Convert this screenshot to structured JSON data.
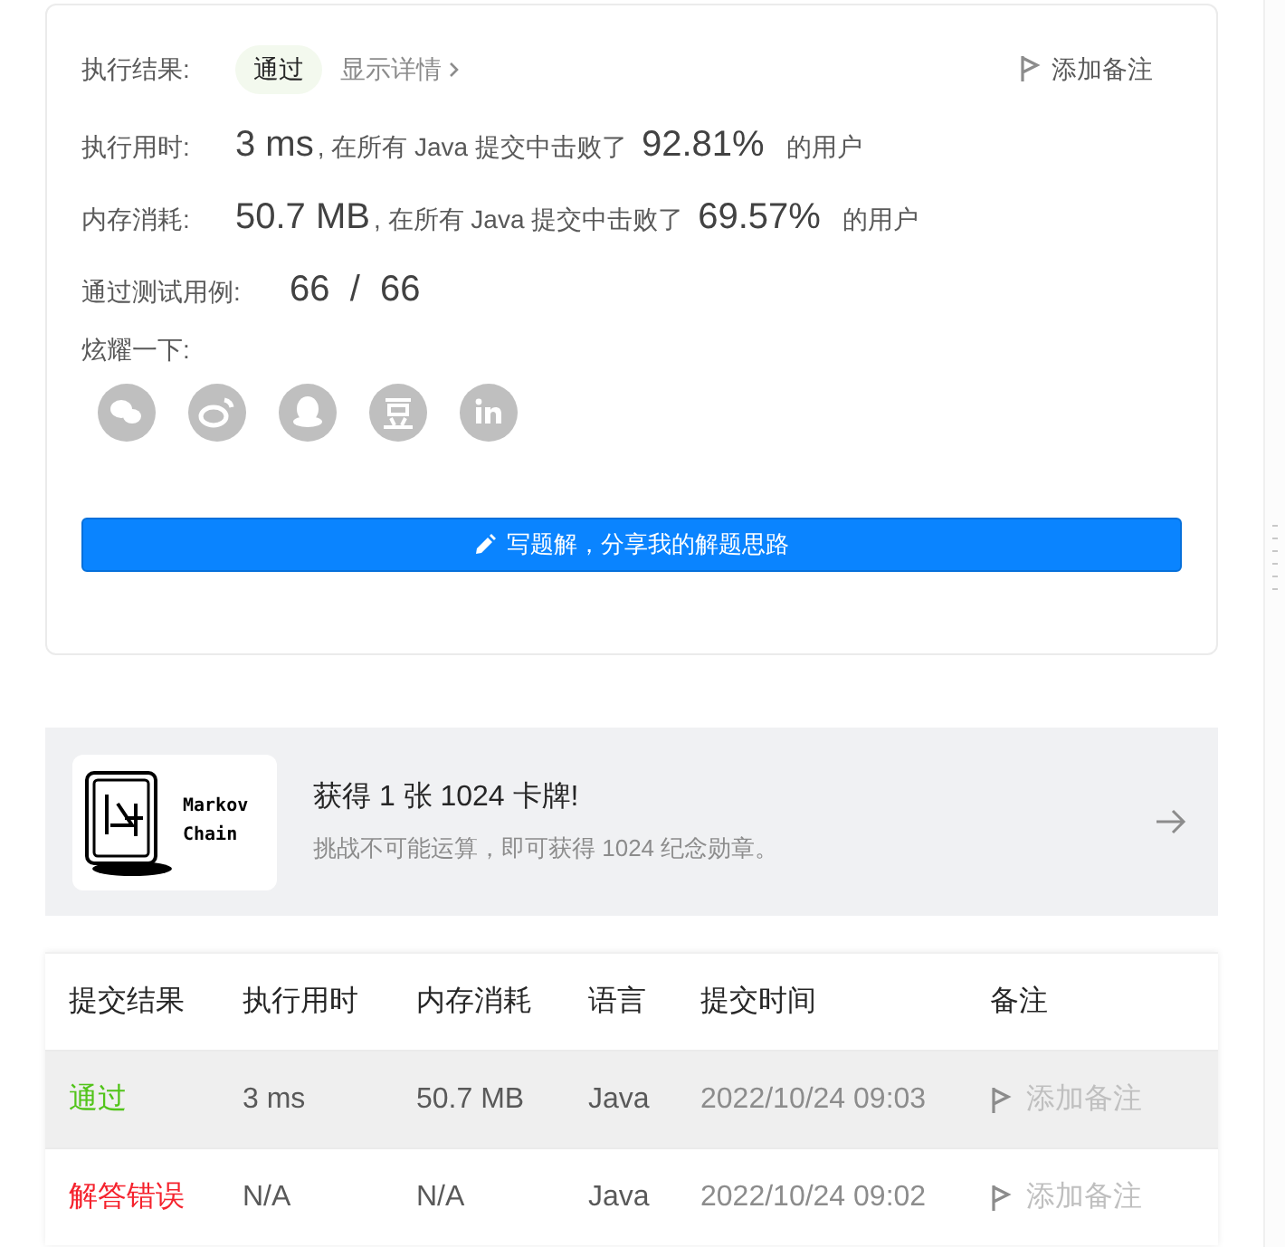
{
  "result": {
    "label": "执行结果:",
    "badge": "通过",
    "details_link": "显示详情",
    "add_note": "添加备注"
  },
  "stats": [
    {
      "label": "执行用时:",
      "value": "3 ms",
      "middle": ", 在所有 Java 提交中击败了",
      "percent": "92.81%",
      "suffix": "的用户"
    },
    {
      "label": "内存消耗:",
      "value": "50.7 MB",
      "middle": ", 在所有 Java 提交中击败了",
      "percent": "69.57%",
      "suffix": "的用户"
    }
  ],
  "tests": {
    "label": "通过测试用例:",
    "value": "66  /  66"
  },
  "share": {
    "label": "炫耀一下:",
    "icons": [
      {
        "kind": "wechat"
      },
      {
        "kind": "weibo"
      },
      {
        "kind": "qq"
      },
      {
        "kind": "douban"
      },
      {
        "kind": "linkedin"
      }
    ]
  },
  "write_button": "写题解，分享我的解题思路",
  "banner": {
    "title": "获得 1 张 1024 卡牌!",
    "subtitle": "挑战不可能运算，即可获得 1024 纪念勋章。",
    "card_text": [
      "Markov",
      "Chain"
    ]
  },
  "table": {
    "columns": [
      "提交结果",
      "执行用时",
      "内存消耗",
      "语言",
      "提交时间",
      "备注"
    ],
    "rows": [
      {
        "status": "通过",
        "color": "#52c41a",
        "time": "3 ms",
        "memory": "50.7 MB",
        "language": "Java",
        "submitted": "2022/10/24 09:03",
        "note": "添加备注",
        "selected": true
      },
      {
        "status": "解答错误",
        "color": "#f5222d",
        "time": "N/A",
        "memory": "N/A",
        "language": "Java",
        "submitted": "2022/10/24 09:02",
        "note": "添加备注",
        "selected": false
      }
    ]
  }
}
